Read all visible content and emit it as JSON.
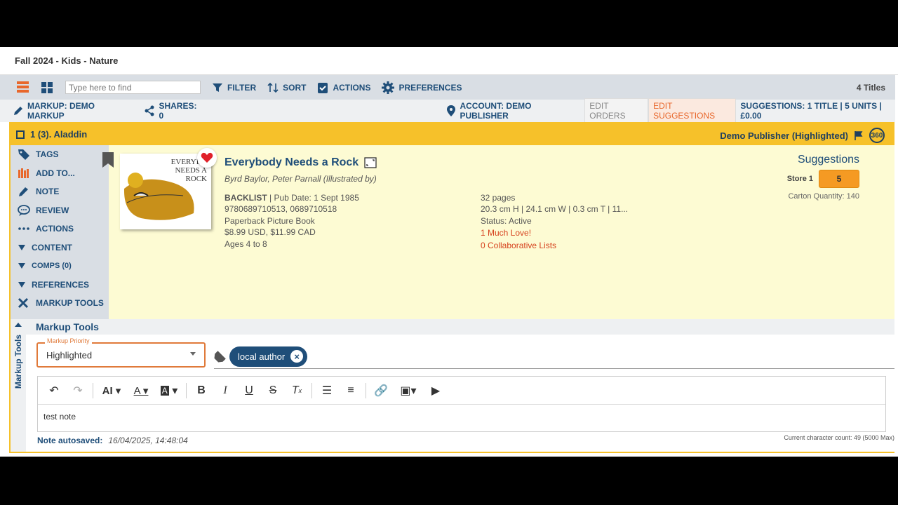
{
  "window_title": "Fall 2024 - Kids - Nature",
  "toolbar": {
    "search_placeholder": "Type here to find",
    "filter": "FILTER",
    "sort": "SORT",
    "actions": "ACTIONS",
    "preferences": "PREFERENCES",
    "title_count": "4 Titles"
  },
  "markupbar": {
    "markup": "MARKUP: DEMO MARKUP",
    "shares": "SHARES: 0",
    "account": "ACCOUNT: DEMO PUBLISHER",
    "edit_orders": "EDIT ORDERS",
    "edit_suggestions": "EDIT SUGGESTIONS",
    "summary": "SUGGESTIONS: 1 TITLE | 5 UNITS | £0.00"
  },
  "row": {
    "heading": "1 (3). Aladdin",
    "publisher": "Demo Publisher (Highlighted)",
    "badge": "360"
  },
  "sidebar": {
    "items": [
      {
        "label": "TAGS",
        "icon": "tag-icon"
      },
      {
        "label": "ADD TO...",
        "icon": "books-icon"
      },
      {
        "label": "NOTE",
        "icon": "pencil-icon"
      },
      {
        "label": "REVIEW",
        "icon": "speech-bubble-icon"
      },
      {
        "label": "ACTIONS",
        "icon": "ellipsis-icon"
      },
      {
        "label": "CONTENT",
        "icon": "triangle-down-icon"
      },
      {
        "label": "COMPS (0)",
        "icon": "triangle-down-icon"
      },
      {
        "label": "REFERENCES",
        "icon": "triangle-down-icon"
      },
      {
        "label": "MARKUP TOOLS",
        "icon": "tools-icon"
      }
    ]
  },
  "book": {
    "title": "Everybody Needs a Rock",
    "authors": "Byrd Baylor, Peter Parnall (Illustrated by)",
    "cover_line1": "EVERYBO",
    "cover_line2": "NEEDS A",
    "cover_line3": "ROCK",
    "status_label": "BACKLIST",
    "pub_date": " | Pub Date: 1 Sept 1985",
    "isbns": "9780689710513, 0689710518",
    "format": "Paperback Picture Book",
    "price": "$8.99 USD, $11.99 CAD",
    "ages": "Ages 4 to 8",
    "pages": "32 pages",
    "dimensions": "20.3 cm H | 24.1 cm W | 0.3 cm T | 11...",
    "status": "Status: Active",
    "loves": "1 Much Love!",
    "lists": "0 Collaborative Lists"
  },
  "suggestions": {
    "heading": "Suggestions",
    "store": "Store 1",
    "quantity": "5",
    "carton": "Carton Quantity: 140"
  },
  "markup_tools": {
    "vertical_label": "Markup Tools",
    "heading": "Markup Tools",
    "priority_label": "Markup Priority",
    "priority_value": "Highlighted",
    "tag": "local author",
    "note_text": "test note",
    "autosave_label": "Note autosaved:",
    "autosave_time": "16/04/2025, 14:48:04",
    "char_count": "Current character count: 49 (5000 Max)"
  },
  "colors": {
    "accent_blue": "#1f4e79",
    "highlight_yellow": "#f6c12a",
    "row_bg": "#fdfbd3",
    "orange": "#f59a23",
    "red": "#d6421e"
  }
}
